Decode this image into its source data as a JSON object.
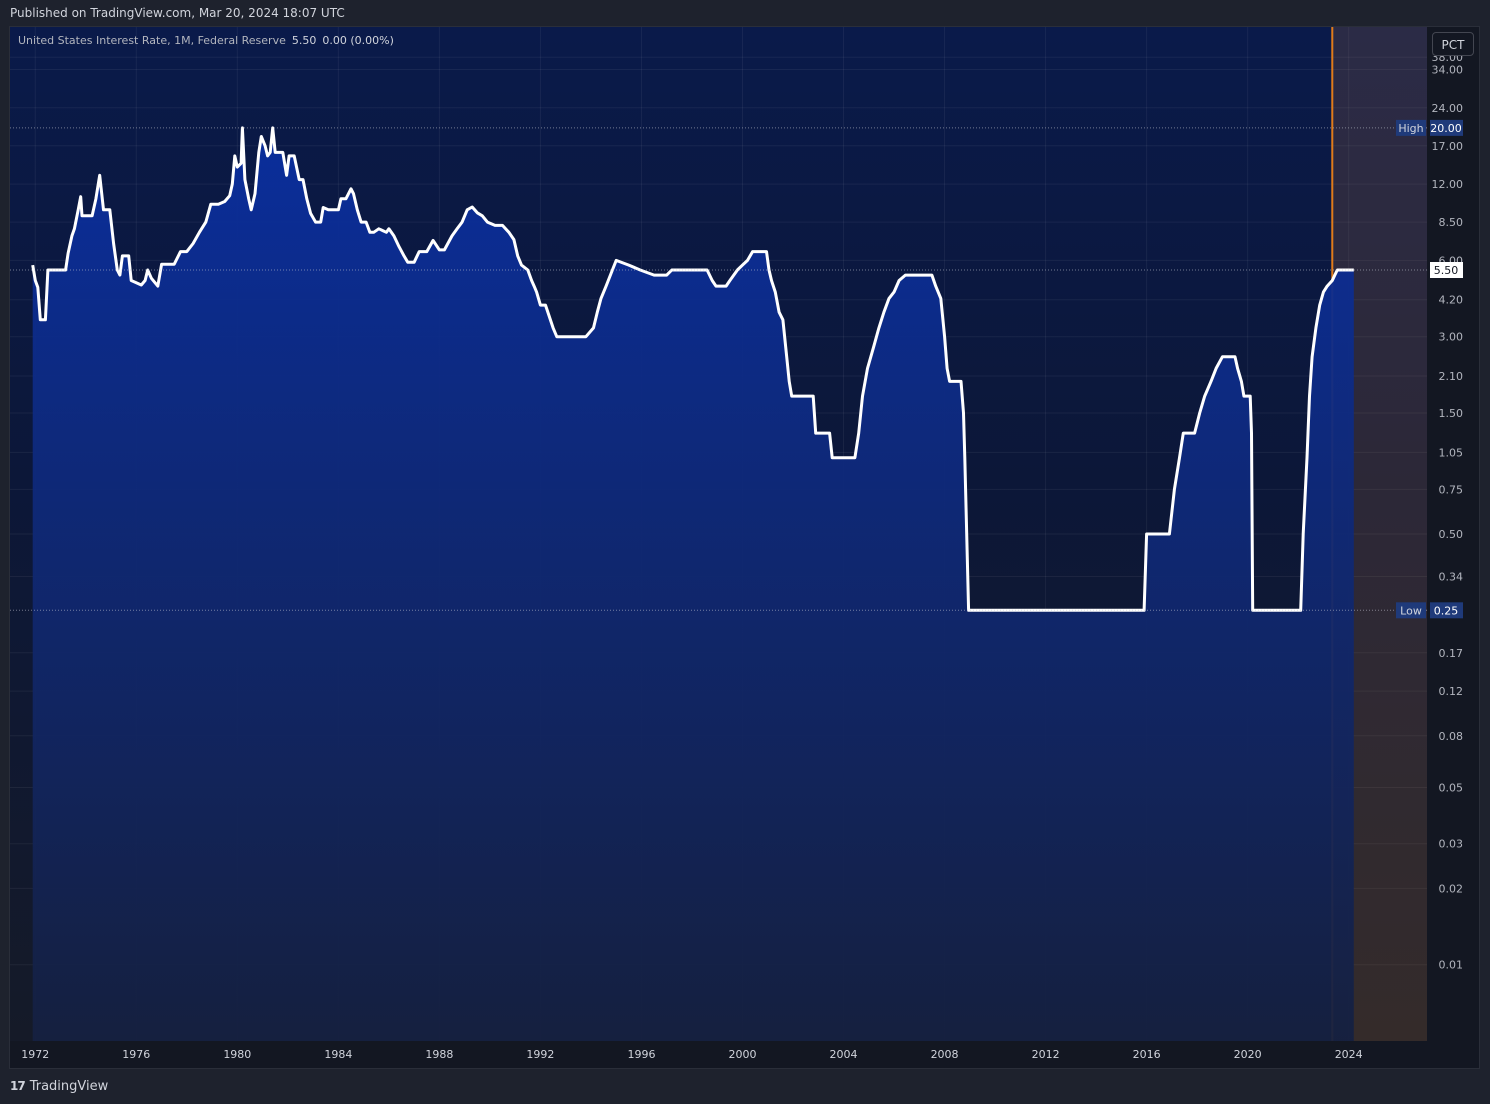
{
  "header": {
    "published": "Published on TradingView.com, Mar 20, 2024 18:07 UTC"
  },
  "legend": {
    "symbol": "United States Interest Rate, 1M, Federal Reserve",
    "last": "5.50",
    "change": "0.00 (0.00%)"
  },
  "scale_button": "PCT",
  "footer": {
    "logo": "17",
    "brand": "TradingView"
  },
  "colors": {
    "background": "#131722",
    "line": "#ffffff",
    "fill_top": "#0a2fa0",
    "fill_bottom": "#152040",
    "highlight_line": "#e07b1a",
    "price_label": "#ffffff",
    "marker_label_bg": "#1f3a7a"
  },
  "chart_data": {
    "type": "area",
    "title": "United States Interest Rate, 1M, Federal Reserve",
    "y_scale": "log",
    "unit": "PCT",
    "ylim": [
      0.005,
      50
    ],
    "xlim": [
      1971.0,
      2027.1
    ],
    "y_ticks": [
      "38.00",
      "34.00",
      "24.00",
      "17.00",
      "12.00",
      "8.50",
      "6.00",
      "4.20",
      "3.00",
      "2.10",
      "1.50",
      "1.05",
      "0.75",
      "0.50",
      "0.34",
      "0.17",
      "0.12",
      "0.08",
      "0.05",
      "0.03",
      "0.02",
      "0.01"
    ],
    "x_ticks": [
      "1972",
      "1976",
      "1980",
      "1984",
      "1988",
      "1992",
      "1996",
      "2000",
      "2004",
      "2008",
      "2012",
      "2016",
      "2020",
      "2024"
    ],
    "high": {
      "label": "High",
      "value": "20.00"
    },
    "low": {
      "label": "Low",
      "value": "0.25"
    },
    "last_value": "5.50",
    "highlight_from": 2023.35,
    "series": [
      {
        "points": [
          [
            1971.9,
            5.75
          ],
          [
            1972.0,
            5.0
          ],
          [
            1972.1,
            4.7
          ],
          [
            1972.2,
            3.5
          ],
          [
            1972.4,
            3.5
          ],
          [
            1972.5,
            5.5
          ],
          [
            1972.8,
            5.5
          ],
          [
            1973.0,
            5.5
          ],
          [
            1973.2,
            5.5
          ],
          [
            1973.3,
            6.4
          ],
          [
            1973.45,
            7.5
          ],
          [
            1973.55,
            8.0
          ],
          [
            1973.7,
            9.5
          ],
          [
            1973.8,
            10.7
          ],
          [
            1973.85,
            9.0
          ],
          [
            1974.0,
            9.0
          ],
          [
            1974.25,
            9.0
          ],
          [
            1974.4,
            10.5
          ],
          [
            1974.55,
            13.0
          ],
          [
            1974.7,
            9.5
          ],
          [
            1974.95,
            9.5
          ],
          [
            1975.1,
            7.0
          ],
          [
            1975.25,
            5.5
          ],
          [
            1975.35,
            5.25
          ],
          [
            1975.45,
            6.25
          ],
          [
            1975.7,
            6.25
          ],
          [
            1975.8,
            5.0
          ],
          [
            1976.0,
            4.9
          ],
          [
            1976.2,
            4.8
          ],
          [
            1976.35,
            5.0
          ],
          [
            1976.45,
            5.5
          ],
          [
            1976.6,
            5.1
          ],
          [
            1976.85,
            4.75
          ],
          [
            1977.0,
            5.8
          ],
          [
            1977.5,
            5.8
          ],
          [
            1977.75,
            6.5
          ],
          [
            1978.0,
            6.5
          ],
          [
            1978.25,
            7.0
          ],
          [
            1978.5,
            7.75
          ],
          [
            1978.75,
            8.5
          ],
          [
            1978.95,
            10.0
          ],
          [
            1979.25,
            10.0
          ],
          [
            1979.5,
            10.25
          ],
          [
            1979.7,
            10.8
          ],
          [
            1979.8,
            12.0
          ],
          [
            1979.9,
            15.5
          ],
          [
            1980.0,
            14.0
          ],
          [
            1980.15,
            14.5
          ],
          [
            1980.2,
            20.0
          ],
          [
            1980.3,
            12.5
          ],
          [
            1980.45,
            10.5
          ],
          [
            1980.55,
            9.5
          ],
          [
            1980.7,
            11.0
          ],
          [
            1980.85,
            16.0
          ],
          [
            1980.95,
            18.5
          ],
          [
            1981.1,
            17.0
          ],
          [
            1981.2,
            15.5
          ],
          [
            1981.3,
            16.0
          ],
          [
            1981.4,
            20.0
          ],
          [
            1981.5,
            16.0
          ],
          [
            1981.8,
            16.0
          ],
          [
            1981.95,
            13.0
          ],
          [
            1982.05,
            15.5
          ],
          [
            1982.25,
            15.5
          ],
          [
            1982.45,
            12.5
          ],
          [
            1982.6,
            12.5
          ],
          [
            1982.75,
            10.5
          ],
          [
            1982.9,
            9.2
          ],
          [
            1983.1,
            8.5
          ],
          [
            1983.3,
            8.5
          ],
          [
            1983.4,
            9.7
          ],
          [
            1983.6,
            9.5
          ],
          [
            1984.0,
            9.5
          ],
          [
            1984.1,
            10.5
          ],
          [
            1984.3,
            10.5
          ],
          [
            1984.5,
            11.5
          ],
          [
            1984.6,
            11.0
          ],
          [
            1984.75,
            9.5
          ],
          [
            1984.9,
            8.5
          ],
          [
            1985.1,
            8.5
          ],
          [
            1985.25,
            7.75
          ],
          [
            1985.4,
            7.75
          ],
          [
            1985.6,
            8.0
          ],
          [
            1985.9,
            7.75
          ],
          [
            1986.0,
            8.0
          ],
          [
            1986.2,
            7.5
          ],
          [
            1986.4,
            6.8
          ],
          [
            1986.6,
            6.25
          ],
          [
            1986.75,
            5.9
          ],
          [
            1987.0,
            5.9
          ],
          [
            1987.2,
            6.5
          ],
          [
            1987.5,
            6.5
          ],
          [
            1987.75,
            7.2
          ],
          [
            1988.0,
            6.6
          ],
          [
            1988.2,
            6.6
          ],
          [
            1988.5,
            7.5
          ],
          [
            1988.7,
            8.0
          ],
          [
            1988.9,
            8.5
          ],
          [
            1989.1,
            9.5
          ],
          [
            1989.3,
            9.75
          ],
          [
            1989.5,
            9.25
          ],
          [
            1989.7,
            9.0
          ],
          [
            1989.9,
            8.5
          ],
          [
            1990.2,
            8.25
          ],
          [
            1990.5,
            8.25
          ],
          [
            1990.75,
            7.75
          ],
          [
            1990.95,
            7.25
          ],
          [
            1991.1,
            6.25
          ],
          [
            1991.25,
            5.75
          ],
          [
            1991.5,
            5.5
          ],
          [
            1991.65,
            5.0
          ],
          [
            1991.75,
            4.75
          ],
          [
            1991.85,
            4.5
          ],
          [
            1992.0,
            4.0
          ],
          [
            1992.2,
            4.0
          ],
          [
            1992.5,
            3.25
          ],
          [
            1992.65,
            3.0
          ],
          [
            1993.0,
            3.0
          ],
          [
            1993.8,
            3.0
          ],
          [
            1994.1,
            3.25
          ],
          [
            1994.25,
            3.75
          ],
          [
            1994.4,
            4.25
          ],
          [
            1994.6,
            4.75
          ],
          [
            1994.85,
            5.5
          ],
          [
            1995.0,
            6.0
          ],
          [
            1995.5,
            5.75
          ],
          [
            1995.95,
            5.5
          ],
          [
            1996.5,
            5.25
          ],
          [
            1997.0,
            5.25
          ],
          [
            1997.2,
            5.5
          ],
          [
            1998.0,
            5.5
          ],
          [
            1998.6,
            5.5
          ],
          [
            1998.8,
            5.0
          ],
          [
            1998.95,
            4.75
          ],
          [
            1999.35,
            4.75
          ],
          [
            1999.5,
            5.0
          ],
          [
            1999.8,
            5.5
          ],
          [
            2000.0,
            5.75
          ],
          [
            2000.2,
            6.0
          ],
          [
            2000.4,
            6.5
          ],
          [
            2000.95,
            6.5
          ],
          [
            2001.05,
            5.5
          ],
          [
            2001.15,
            5.0
          ],
          [
            2001.3,
            4.5
          ],
          [
            2001.45,
            3.75
          ],
          [
            2001.6,
            3.5
          ],
          [
            2001.75,
            2.5
          ],
          [
            2001.85,
            2.0
          ],
          [
            2001.95,
            1.75
          ],
          [
            2002.8,
            1.75
          ],
          [
            2002.9,
            1.25
          ],
          [
            2003.45,
            1.25
          ],
          [
            2003.55,
            1.0
          ],
          [
            2004.45,
            1.0
          ],
          [
            2004.6,
            1.25
          ],
          [
            2004.75,
            1.75
          ],
          [
            2004.95,
            2.25
          ],
          [
            2005.2,
            2.75
          ],
          [
            2005.4,
            3.25
          ],
          [
            2005.6,
            3.75
          ],
          [
            2005.8,
            4.25
          ],
          [
            2006.0,
            4.5
          ],
          [
            2006.2,
            5.0
          ],
          [
            2006.45,
            5.25
          ],
          [
            2007.5,
            5.25
          ],
          [
            2007.65,
            4.75
          ],
          [
            2007.85,
            4.25
          ],
          [
            2008.0,
            3.0
          ],
          [
            2008.1,
            2.25
          ],
          [
            2008.2,
            2.0
          ],
          [
            2008.65,
            2.0
          ],
          [
            2008.75,
            1.5
          ],
          [
            2008.8,
            1.0
          ],
          [
            2008.95,
            0.25
          ],
          [
            2015.9,
            0.25
          ],
          [
            2016.0,
            0.5
          ],
          [
            2016.9,
            0.5
          ],
          [
            2017.1,
            0.75
          ],
          [
            2017.3,
            1.0
          ],
          [
            2017.45,
            1.25
          ],
          [
            2017.9,
            1.25
          ],
          [
            2018.1,
            1.5
          ],
          [
            2018.3,
            1.75
          ],
          [
            2018.55,
            2.0
          ],
          [
            2018.75,
            2.25
          ],
          [
            2019.0,
            2.5
          ],
          [
            2019.5,
            2.5
          ],
          [
            2019.6,
            2.25
          ],
          [
            2019.75,
            2.0
          ],
          [
            2019.85,
            1.75
          ],
          [
            2020.1,
            1.75
          ],
          [
            2020.15,
            1.25
          ],
          [
            2020.2,
            0.25
          ],
          [
            2022.1,
            0.25
          ],
          [
            2022.2,
            0.5
          ],
          [
            2022.35,
            1.0
          ],
          [
            2022.45,
            1.75
          ],
          [
            2022.55,
            2.5
          ],
          [
            2022.7,
            3.25
          ],
          [
            2022.85,
            4.0
          ],
          [
            2023.0,
            4.5
          ],
          [
            2023.15,
            4.75
          ],
          [
            2023.35,
            5.0
          ],
          [
            2023.45,
            5.25
          ],
          [
            2023.55,
            5.5
          ],
          [
            2024.2,
            5.5
          ]
        ]
      }
    ]
  }
}
